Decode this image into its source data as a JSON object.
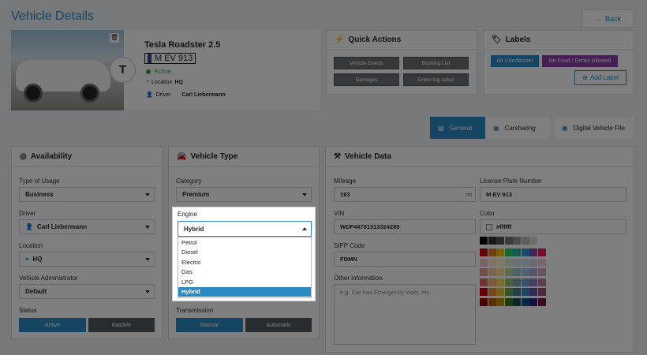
{
  "page": {
    "title": "Vehicle Details",
    "back_label": "Back"
  },
  "vehicle": {
    "name": "Tesla Roadster 2.5",
    "plate": "M EV 913",
    "status": "Active",
    "location_label": "Location",
    "location": "HQ",
    "driver_label": "Driver",
    "driver": "Carl Liebermann"
  },
  "quick_actions": {
    "title": "Quick Actions",
    "buttons": [
      "Vehicle Events",
      "Booking List",
      "Damages",
      "Driver log setup"
    ]
  },
  "labels": {
    "title": "Labels",
    "chips": [
      {
        "text": "Air Conditioner",
        "color": "#2b8ac4"
      },
      {
        "text": "No Food / Drinks Allowed",
        "color": "#8b3fa6"
      }
    ],
    "add_label": "Add Label"
  },
  "tabs": [
    {
      "label": "General",
      "active": true
    },
    {
      "label": "Carsharing",
      "active": false
    },
    {
      "label": "Digital Vehicle File",
      "active": false
    }
  ],
  "availability": {
    "title": "Availability",
    "type_label": "Type of Usage",
    "type_value": "Business",
    "driver_label": "Driver",
    "driver_value": "Carl Liebermann",
    "location_label": "Location",
    "location_value": "HQ",
    "admin_label": "Vehicle Administrator",
    "admin_value": "Default",
    "status_label": "Status",
    "status_active": "Active",
    "status_inactive": "Inactive"
  },
  "vehicle_type": {
    "title": "Vehicle Type",
    "category_label": "Category",
    "category_value": "Premium",
    "engine_label": "Engine",
    "engine_value": "Hybrid",
    "engine_options": [
      "Petrol",
      "Diesel",
      "Electric",
      "Gas",
      "LPG",
      "Hybrid"
    ],
    "engine_selected": "Hybrid",
    "transmission_label": "Transmission",
    "manual": "Manual",
    "automatic": "Automatic"
  },
  "vehicle_data": {
    "title": "Vehicle Data",
    "mileage_label": "Mileage",
    "mileage_value": "193",
    "mileage_unit": "mi",
    "vin_label": "VIN",
    "vin_value": "WDF44781313324288",
    "sipp_label": "SIPP Code",
    "sipp_value": "FDMN",
    "other_label": "Other information",
    "other_placeholder": "e.g. Car has Emergency tools, etc.",
    "plate_label": "License Plate Number",
    "plate_value": "M EV 913",
    "color_label": "Color",
    "color_value": "#ffffff"
  },
  "colors": {
    "accent": "#2b8ac4",
    "status_green": "#27a844",
    "purple": "#8b3fa6"
  }
}
